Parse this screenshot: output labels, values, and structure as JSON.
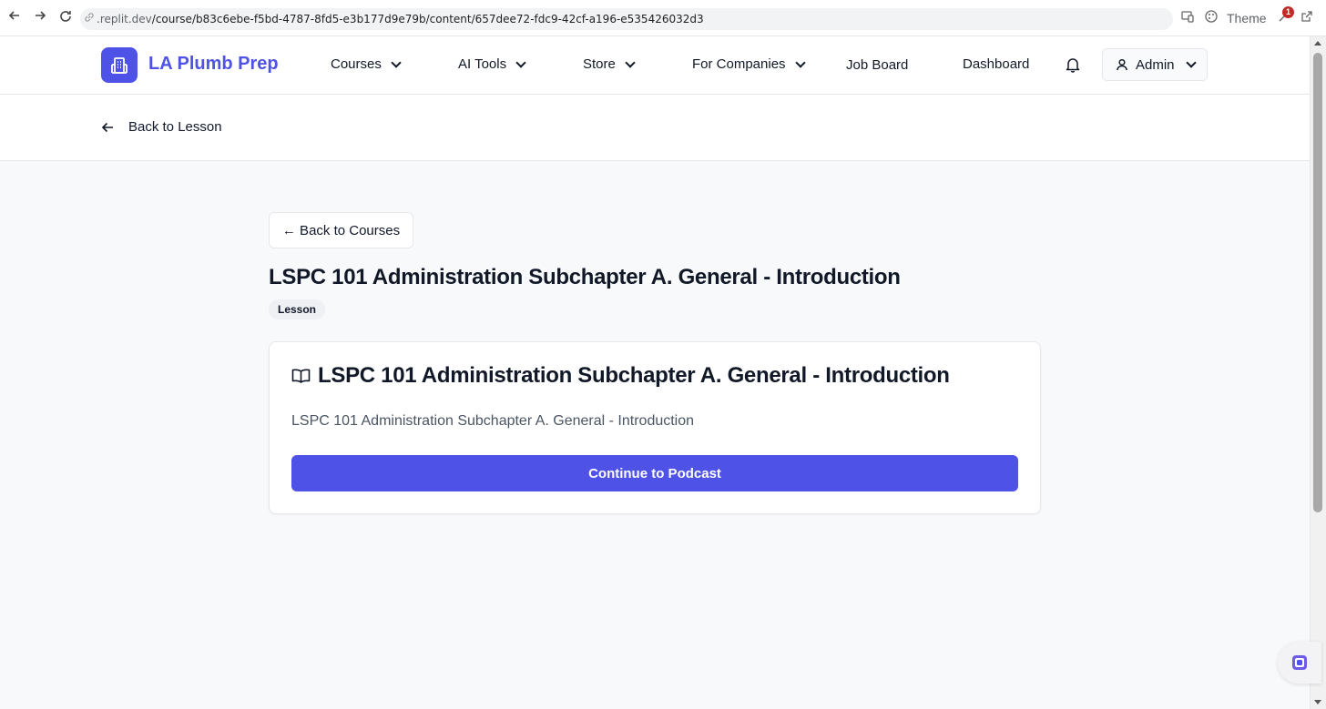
{
  "browser": {
    "url_dim": ".replit.dev",
    "url_path": "/course/b83c6ebe-f5bd-4787-8fd5-e3b177d9e79b/content/657dee72-fdc9-42cf-a196-e535426032d3",
    "theme_label": "Theme",
    "extension_badge": "1"
  },
  "header": {
    "brand": "LA Plumb Prep",
    "nav": [
      {
        "label": "Courses",
        "dropdown": true
      },
      {
        "label": "AI Tools",
        "dropdown": true
      },
      {
        "label": "Store",
        "dropdown": true
      },
      {
        "label": "For Companies",
        "dropdown": true
      },
      {
        "label": "Job Board",
        "dropdown": false
      },
      {
        "label": "Dashboard",
        "dropdown": false
      }
    ],
    "user_label": "Admin"
  },
  "subheader": {
    "back_label": "Back to Lesson"
  },
  "main": {
    "back_courses_label": "← Back to Courses",
    "title": "LSPC 101 Administration Subchapter A. General - Introduction",
    "badge": "Lesson",
    "card": {
      "title": "LSPC 101 Administration Subchapter A. General - Introduction",
      "description": "LSPC 101 Administration Subchapter A. General - Introduction",
      "button_label": "Continue to Podcast"
    }
  },
  "colors": {
    "brand": "#4f52e6",
    "page_bg": "#f8f9fb",
    "text": "#111827",
    "muted": "#4b5563"
  },
  "icons": [
    "back-icon",
    "forward-icon",
    "reload-icon",
    "link-icon",
    "cast-icon",
    "palette-icon",
    "extension-icon",
    "external-icon",
    "building-icon",
    "chevron-down-icon",
    "bell-icon",
    "user-icon",
    "arrow-left-icon",
    "book-open-icon",
    "assistant-icon"
  ]
}
